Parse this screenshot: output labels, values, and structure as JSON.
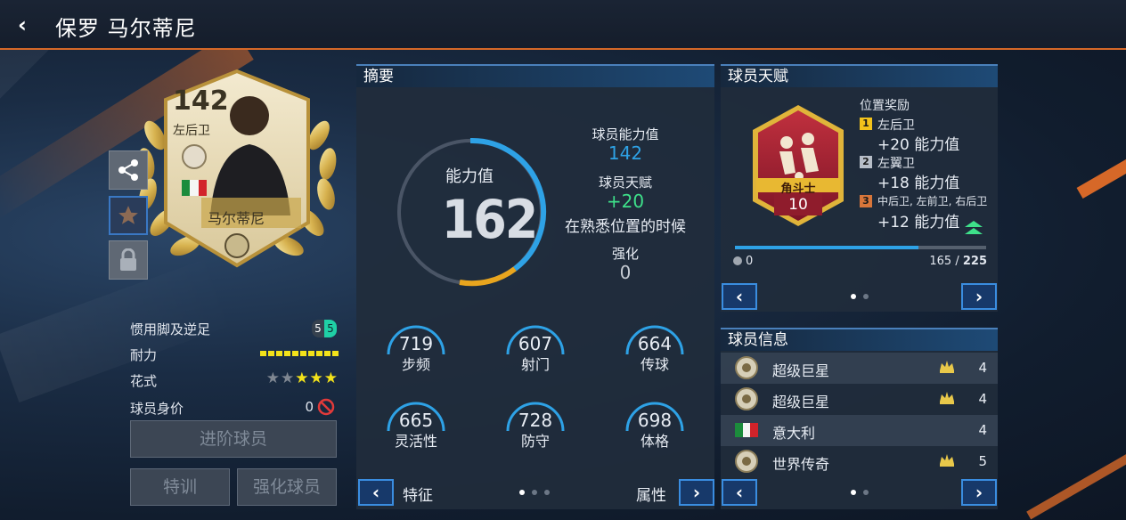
{
  "header": {
    "title": "保罗 马尔蒂尼"
  },
  "card": {
    "rating": "142",
    "position": "左后卫",
    "name": "马尔蒂尼"
  },
  "stats_list": {
    "foot_label": "惯用脚及逆足",
    "foot_values": [
      "5",
      "5"
    ],
    "stamina_label": "耐力",
    "skill_label": "花式",
    "skill_stars": 3,
    "skill_stars_max": 5,
    "value_label": "球员身价",
    "value": "0"
  },
  "buttons": {
    "advance": "进阶球员",
    "train": "特训",
    "enhance": "强化球员"
  },
  "summary": {
    "header": "摘要",
    "ovr_label": "能力值",
    "ovr_value": "162",
    "ability_label": "球员能力值",
    "ability_value": "142",
    "talent_label": "球员天赋",
    "talent_value": "+20",
    "talent_note": "在熟悉位置的时候",
    "enhance_label": "强化",
    "enhance_value": "0",
    "sub_stats": [
      {
        "value": "719",
        "name": "步频"
      },
      {
        "value": "607",
        "name": "射门"
      },
      {
        "value": "664",
        "name": "传球"
      },
      {
        "value": "665",
        "name": "灵活性"
      },
      {
        "value": "728",
        "name": "防守"
      },
      {
        "value": "698",
        "name": "体格"
      }
    ],
    "footer_left": "特征",
    "footer_right": "属性"
  },
  "talent": {
    "header": "球员天赋",
    "badge_name": "角斗士",
    "badge_level": "10",
    "bonus_header": "位置奖励",
    "bonuses": [
      {
        "rank": "1",
        "positions": "左后卫",
        "value": "+20 能力值",
        "color": "#f2c21b"
      },
      {
        "rank": "2",
        "positions": "左翼卫",
        "value": "+18 能力值",
        "color": "#b7bec8"
      },
      {
        "rank": "3",
        "positions": "中后卫, 左前卫, 右后卫",
        "value": "+12 能力值",
        "color": "#d8763a"
      }
    ],
    "progress_left": "0",
    "progress_current": "165",
    "progress_separator": "/",
    "progress_max": "225",
    "progress_fraction": 0.73
  },
  "info": {
    "header": "球员信息",
    "rows": [
      {
        "text": "超级巨星",
        "num": "4"
      },
      {
        "text": "超级巨星",
        "num": "4"
      },
      {
        "text": "意大利",
        "num": "4"
      },
      {
        "text": "世界传奇",
        "num": "5"
      }
    ]
  },
  "colors": {
    "accent_orange": "#d66828",
    "accent_blue": "#2ea2e6",
    "talent_green": "#3ee08a",
    "star_yellow": "#f3e21a"
  }
}
